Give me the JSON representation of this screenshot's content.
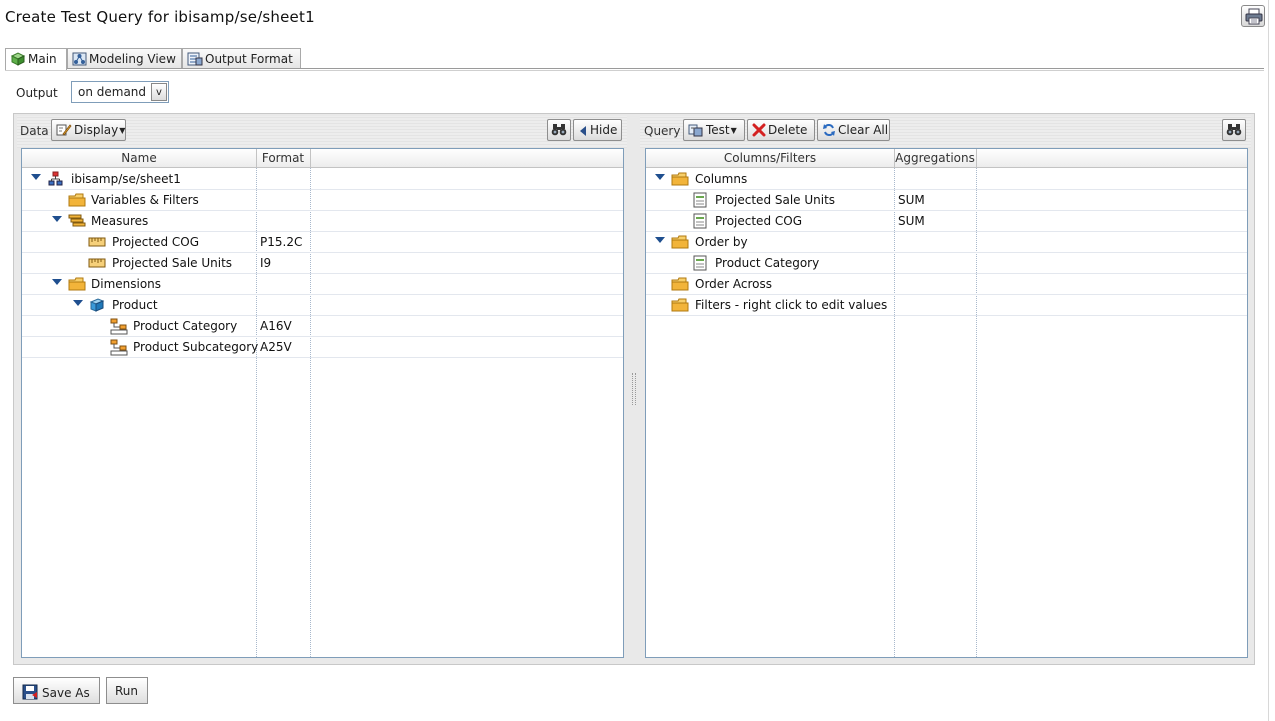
{
  "window": {
    "title": "Create Test Query for ibisamp/se/sheet1"
  },
  "tabs": [
    {
      "label": "Main",
      "icon": "cube-icon",
      "active": true
    },
    {
      "label": "Modeling View",
      "icon": "modeling-icon",
      "active": false
    },
    {
      "label": "Output Format",
      "icon": "output-format-icon",
      "active": false
    }
  ],
  "output": {
    "label": "Output",
    "value": "on demand",
    "arrow": "v"
  },
  "data_panel": {
    "label": "Data",
    "display_button": "Display",
    "hide_button": "Hide",
    "columns": [
      "Name",
      "Format"
    ],
    "rows": [
      {
        "label": "ibisamp/se/sheet1",
        "format": "",
        "icon": "datasource-icon",
        "expanded": true,
        "level": 0
      },
      {
        "label": "Variables & Filters",
        "format": "",
        "icon": "folder-icon",
        "expanded": null,
        "level": 1
      },
      {
        "label": "Measures",
        "format": "",
        "icon": "measures-icon",
        "expanded": true,
        "level": 1
      },
      {
        "label": "Projected COG",
        "format": "P15.2C",
        "icon": "measure-field-icon",
        "expanded": null,
        "level": 2
      },
      {
        "label": "Projected Sale Units",
        "format": "I9",
        "icon": "measure-field-icon",
        "expanded": null,
        "level": 2
      },
      {
        "label": "Dimensions",
        "format": "",
        "icon": "folder-icon",
        "expanded": true,
        "level": 1
      },
      {
        "label": "Product",
        "format": "",
        "icon": "dimension-icon",
        "expanded": true,
        "level": 2
      },
      {
        "label": "Product Category",
        "format": "A16V",
        "icon": "hierarchy-level-icon",
        "expanded": null,
        "level": 3
      },
      {
        "label": "Product Subcategory",
        "format": "A25V",
        "icon": "hierarchy-level-icon",
        "expanded": null,
        "level": 3
      }
    ]
  },
  "query_panel": {
    "label": "Query",
    "test_button": "Test",
    "delete_button": "Delete",
    "clear_button": "Clear All",
    "columns": [
      "Columns/Filters",
      "Aggregations"
    ],
    "rows": [
      {
        "label": "Columns",
        "agg": "",
        "icon": "folder-icon",
        "expanded": true,
        "level": 0
      },
      {
        "label": "Projected Sale Units",
        "agg": "SUM",
        "icon": "field-icon",
        "expanded": null,
        "level": 1
      },
      {
        "label": "Projected COG",
        "agg": "SUM",
        "icon": "field-icon",
        "expanded": null,
        "level": 1
      },
      {
        "label": "Order by",
        "agg": "",
        "icon": "folder-icon",
        "expanded": true,
        "level": 0
      },
      {
        "label": "Product Category",
        "agg": "",
        "icon": "field-icon",
        "expanded": null,
        "level": 1
      },
      {
        "label": "Order Across",
        "agg": "",
        "icon": "folder-icon",
        "expanded": null,
        "level": 0
      },
      {
        "label": "Filters - right click to edit values",
        "agg": "",
        "icon": "folder-icon",
        "expanded": null,
        "level": 0
      }
    ]
  },
  "footer": {
    "save_as": "Save As",
    "run": "Run"
  },
  "colors": {
    "grid_border": "#7f9db9",
    "twisty": "#1f4f8f",
    "folder": "#f2b43a",
    "delete_red": "#d42020"
  }
}
